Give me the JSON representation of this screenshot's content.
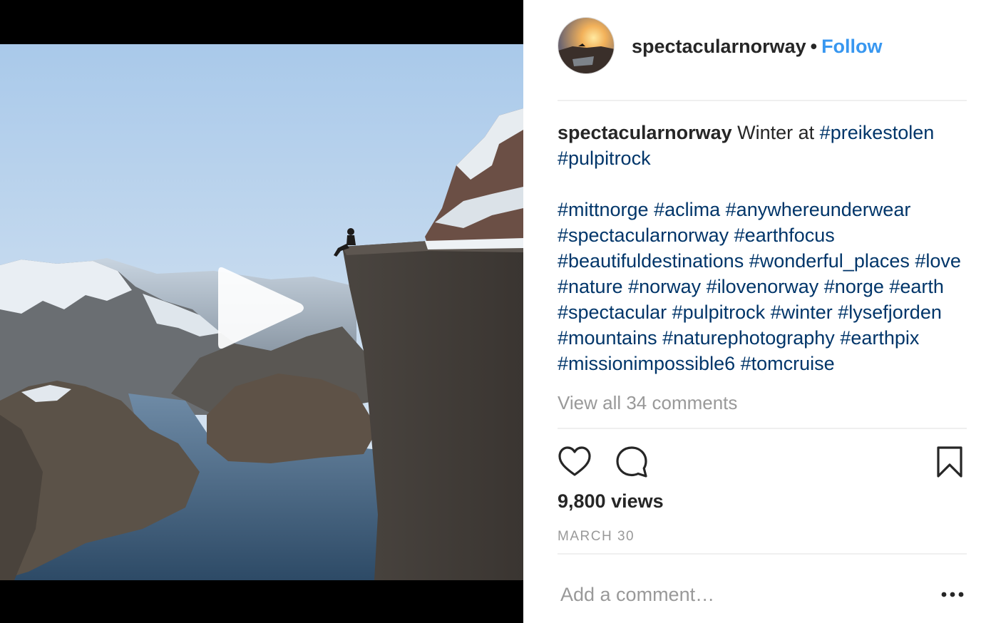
{
  "post": {
    "username": "spectacularnorway",
    "separator": "•",
    "follow_label": "Follow",
    "caption": {
      "username": "spectacularnorway",
      "text_intro": "Winter at",
      "tags_first": [
        "#preikestolen",
        "#pulpitrock"
      ],
      "tags_rest": [
        "#mittnorge",
        "#aclima",
        "#anywhereunderwear",
        "#spectacularnorway",
        "#earthfocus",
        "#beautifuldestinations",
        "#wonderful_places",
        "#love",
        "#nature",
        "#norway",
        "#ilovenorway",
        "#norge",
        "#earth",
        "#spectacular",
        "#pulpitrock",
        "#winter",
        "#lysefjorden",
        "#mountains",
        "#naturephotography",
        "#earthpix",
        "#missionimpossible6",
        "#tomcruise"
      ]
    },
    "view_comments_label": "View all 34 comments",
    "views_label": "9,800 views",
    "date_label": "MARCH 30",
    "comment_placeholder": "Add a comment…"
  },
  "icons": {
    "like": "heart-icon",
    "comment": "speech-bubble-icon",
    "save": "bookmark-icon",
    "more": "ellipsis-icon",
    "play": "play-icon"
  },
  "colors": {
    "link_blue": "#3897f0",
    "hashtag": "#003569",
    "muted": "#999999",
    "text": "#262626",
    "divider": "#efefef"
  }
}
